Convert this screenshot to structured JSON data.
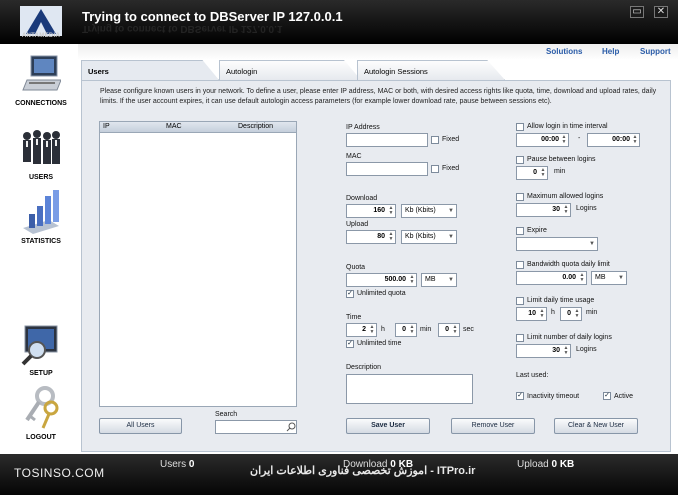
{
  "app": {
    "logo_text": "ANTAMEDIA",
    "title": "Trying to connect to DBServer IP 127.0.0.1",
    "window_buttons": [
      "▭",
      "✕"
    ]
  },
  "toplinks": [
    "Solutions",
    "Help",
    "Support"
  ],
  "sidebar": {
    "items": [
      {
        "label": "CONNECTIONS",
        "icon": "monitor-icon"
      },
      {
        "label": "USERS",
        "icon": "people-icon"
      },
      {
        "label": "STATISTICS",
        "icon": "bar-chart-icon"
      },
      {
        "label": "SETUP",
        "icon": "magnifier-icon"
      },
      {
        "label": "LOGOUT",
        "icon": "keys-icon"
      }
    ]
  },
  "tabs": [
    "Users",
    "Autologin",
    "Autologin Sessions"
  ],
  "info_text": "Please configure known users in your network. To define a user, please enter IP address, MAC or both, with desired access rights like quota, time, download and upload rates, daily limits. If the user account expires, it can use default autologin access parameters (for example lower download rate, pause between sessions etc).",
  "list": {
    "columns": [
      "IP",
      "MAC",
      "Description"
    ],
    "all_users_button": "All Users",
    "search_label": "Search",
    "search_value": ""
  },
  "form": {
    "ip_label": "IP Address",
    "ip_value": "",
    "fixed_label": "Fixed",
    "mac_label": "MAC",
    "mac_value": "",
    "download_label": "Download",
    "download_value": "160",
    "download_unit": "Kb (Kbits)",
    "upload_label": "Upload",
    "upload_value": "80",
    "upload_unit": "Kb (Kbits)",
    "quota_label": "Quota",
    "quota_value": "500.00",
    "quota_unit": "MB",
    "unlimited_quota_label": "Unlimited quota",
    "time_label": "Time",
    "time_h": "2",
    "h_label": "h",
    "time_min": "0",
    "min_label": "min",
    "time_sec": "0",
    "sec_label": "sec",
    "unlimited_time_label": "Unlimited time",
    "description_label": "Description",
    "description_value": ""
  },
  "right": {
    "allow_interval_label": "Allow login in time interval",
    "interval_from": "00:00",
    "interval_sep": "-",
    "interval_to": "00:00",
    "pause_label": "Pause between logins",
    "pause_value": "0",
    "pause_unit": "min",
    "max_logins_label": "Maximum allowed logins",
    "max_logins_value": "30",
    "max_logins_unit": "Logins",
    "expire_label": "Expire",
    "expire_value": "",
    "bw_quota_label": "Bandwidth quota daily limit",
    "bw_quota_value": "0.00",
    "bw_quota_unit": "MB",
    "daily_time_label": "Limit daily time usage",
    "daily_h": "10",
    "daily_min": "0",
    "h_label": "h",
    "min_label": "min",
    "limit_logins_label": "Limit number of daily logins",
    "limit_logins_value": "30",
    "limit_logins_unit": "Logins",
    "last_used_label": "Last used:",
    "inactivity_label": "Inactivity timeout",
    "active_label": "Active"
  },
  "buttons": {
    "save": "Save User",
    "remove": "Remove User",
    "clear_new": "Clear & New User"
  },
  "status": {
    "users_label": "Users",
    "users_value": "0",
    "download_label": "Download",
    "download_value": "0 KB",
    "upload_label": "Upload",
    "upload_value": "0 KB"
  },
  "watermark": {
    "left": "TOSINSO.COM",
    "center": "اموزش تخصصی فناوری اطلاعات ایران - ITPro.ir"
  }
}
